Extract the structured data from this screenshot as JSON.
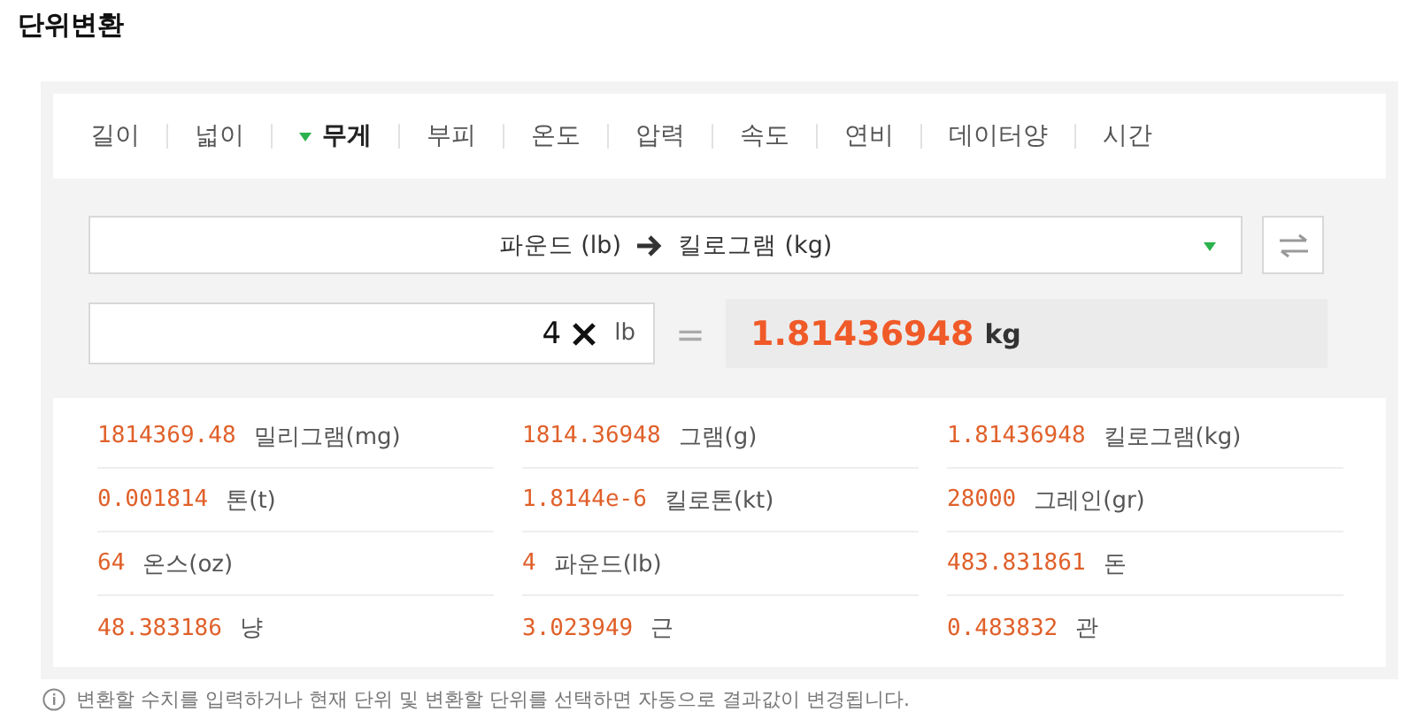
{
  "title": "단위변환",
  "tabs": [
    {
      "label": "길이",
      "selected": false
    },
    {
      "label": "넓이",
      "selected": false
    },
    {
      "label": "무게",
      "selected": true
    },
    {
      "label": "부피",
      "selected": false
    },
    {
      "label": "온도",
      "selected": false
    },
    {
      "label": "압력",
      "selected": false
    },
    {
      "label": "속도",
      "selected": false
    },
    {
      "label": "연비",
      "selected": false
    },
    {
      "label": "데이터양",
      "selected": false
    },
    {
      "label": "시간",
      "selected": false
    }
  ],
  "converter": {
    "from_unit": "파운드 (lb)",
    "to_unit": "킬로그램 (kg)",
    "input_value": "4",
    "input_unit": "lb",
    "equals": "=",
    "result_value": "1.81436948",
    "result_unit": "kg"
  },
  "results": [
    {
      "value": "1814369.48",
      "unit": "밀리그램(mg)"
    },
    {
      "value": "1814.36948",
      "unit": "그램(g)"
    },
    {
      "value": "1.81436948",
      "unit": "킬로그램(kg)"
    },
    {
      "value": "0.001814",
      "unit": "톤(t)"
    },
    {
      "value": "1.8144e-6",
      "unit": "킬로톤(kt)"
    },
    {
      "value": "28000",
      "unit": "그레인(gr)"
    },
    {
      "value": "64",
      "unit": "온스(oz)"
    },
    {
      "value": "4",
      "unit": "파운드(lb)"
    },
    {
      "value": "483.831861",
      "unit": "돈"
    },
    {
      "value": "48.383186",
      "unit": "냥"
    },
    {
      "value": "3.023949",
      "unit": "근"
    },
    {
      "value": "0.483832",
      "unit": "관"
    }
  ],
  "note": "변환할 수치를 입력하거나 현재 단위 및 변환할 단위를 선택하면 자동으로 결과값이 변경됩니다."
}
